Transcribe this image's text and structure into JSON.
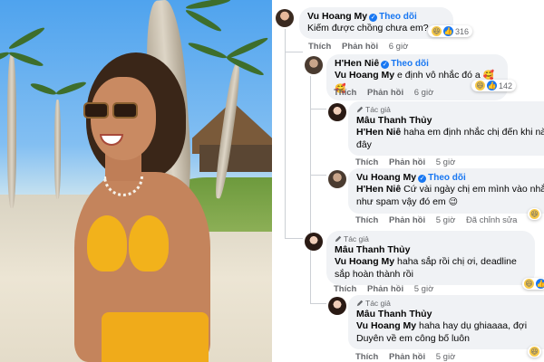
{
  "comments": [
    {
      "name": "Vu Hoang My",
      "follow": "Theo dõi",
      "text": "Kiếm được chồng chưa em?",
      "reaction_count": "316",
      "like": "Thích",
      "reply": "Phản hồi",
      "time": "6 giờ"
    },
    {
      "name": "H'Hen Niê",
      "follow": "Theo dõi",
      "mention": "Vu Hoang My",
      "text": " e định vô nhắc đó a",
      "emoji": "🥰🥰",
      "reaction_count": "142",
      "like": "Thích",
      "reply": "Phản hồi",
      "time": "6 giờ"
    },
    {
      "author_tag": "Tác giả",
      "name": "Mâu Thanh Thủy",
      "mention": "H'Hen Niê",
      "text": " haha em định nhắc chị đến khi nà đây",
      "like": "Thích",
      "reply": "Phản hồi",
      "time": "5 giờ"
    },
    {
      "name": "Vu Hoang My",
      "follow": "Theo dõi",
      "mention": "H'Hen Niê",
      "text": " Cứ vài ngày chị em mình vào nhắ như spam vậy đó em",
      "emoji": "😉",
      "like": "Thích",
      "reply": "Phản hồi",
      "time": "5 giờ",
      "edited": "Đã chỉnh sửa"
    },
    {
      "author_tag": "Tác giả",
      "name": "Mâu Thanh Thủy",
      "mention": "Vu Hoang My",
      "text": " haha sắp rồi chị ơi, deadline sắp hoàn thành rồi",
      "like": "Thích",
      "reply": "Phản hồi",
      "time": "5 giờ"
    },
    {
      "author_tag": "Tác giả",
      "name": "Mâu Thanh Thủy",
      "mention": "Vu Hoang My",
      "text": " haha hay dụ ghiaaaa, đợi Duyên về em công bố luôn",
      "like": "Thích",
      "reply": "Phản hồi",
      "time": "5 giờ"
    }
  ],
  "colors": {
    "bubble": "#f0f2f5",
    "link": "#1877f2",
    "meta": "#65676b",
    "bikini": "#f2b21b"
  },
  "icons": {
    "verified": "verified-badge-icon",
    "haha": "haha-reaction-icon",
    "like": "like-reaction-icon",
    "author": "pen-author-icon"
  }
}
